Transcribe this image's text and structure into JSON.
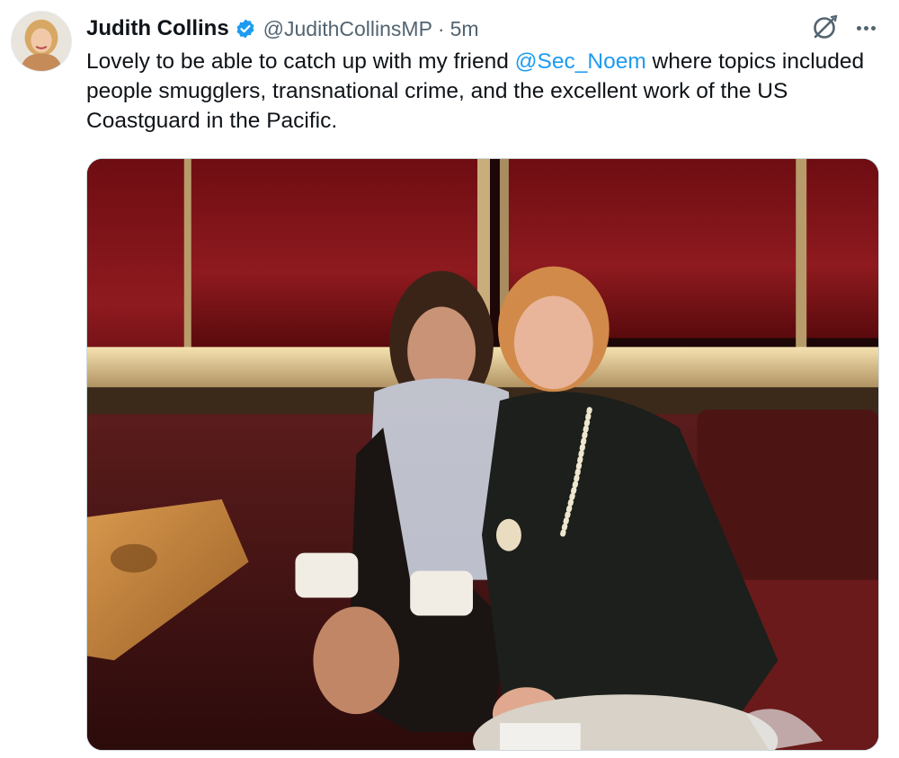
{
  "author": {
    "display_name": "Judith Collins",
    "handle": "@JudithCollinsMP",
    "separator": "·",
    "timestamp": "5m",
    "verified": true,
    "avatar_icon": "profile-photo"
  },
  "tweet": {
    "text_before": "Lovely to be able to catch up with  my friend ",
    "mention": "@Sec_Noem",
    "text_after": " where topics included people smugglers, transnational crime, and the excellent work of the US Coastguard in the Pacific."
  },
  "actions": {
    "grok_icon": "grok-icon",
    "more_icon": "more-options-icon"
  },
  "media": {
    "type": "photo"
  },
  "colors": {
    "accent": "#1d9bf0",
    "text": "#0f1419",
    "muted": "#536471"
  }
}
